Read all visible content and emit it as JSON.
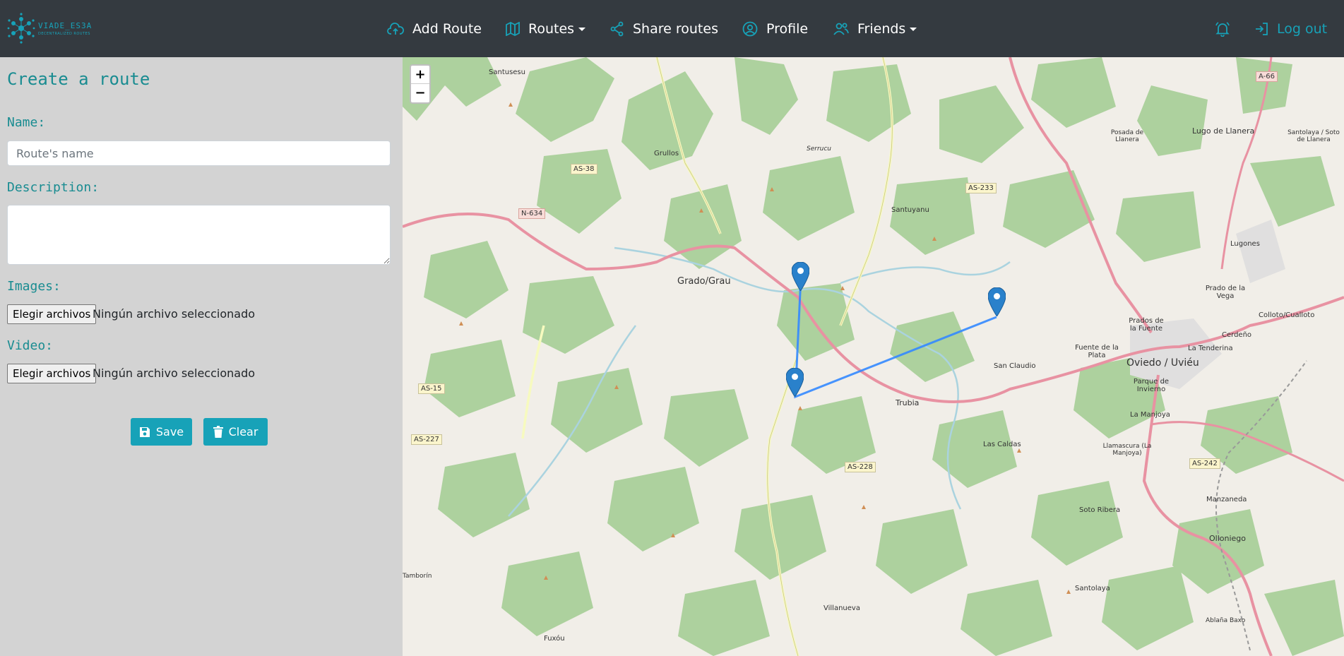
{
  "brand": {
    "title": "VIADE_ES3A",
    "subtitle": "DECENTRALIZED ROUTES",
    "logo_icon": "network-logo-icon"
  },
  "nav": {
    "add_route": "Add Route",
    "routes": "Routes",
    "share_routes": "Share routes",
    "profile": "Profile",
    "friends": "Friends",
    "notifications_icon": "bell-icon",
    "logout": "Log out"
  },
  "form": {
    "title": "Create a route",
    "name_label": "Name:",
    "name_placeholder": "Route's name",
    "name_value": "",
    "description_label": "Description:",
    "description_value": "",
    "images_label": "Images:",
    "video_label": "Video:",
    "choose_files": "Elegir archivos",
    "no_file": "Ningún archivo seleccionado",
    "save": "Save",
    "clear": "Clear"
  },
  "map": {
    "zoom_in": "+",
    "zoom_out": "−",
    "places": [
      "Santusesu",
      "Grullos",
      "Serrucu",
      "Santuyanu",
      "Grado/Grau",
      "Trubia",
      "San Claudio",
      "Las Caldas",
      "Posada de Llanera",
      "Lugo de Llanera",
      "Santolaya / Soto de Llanera",
      "Lugones",
      "Prado de la Vega",
      "Colloto/Cualloto",
      "Prados de la Fuente",
      "Cerdeño",
      "Fuente de la Plata",
      "La Tenderina",
      "Oviedo / Uviéu",
      "Parque de Invierno",
      "La Manjoya",
      "Llamascura (La Manjoya)",
      "Manzaneda",
      "Soto Ribera",
      "Olloniego",
      "Santolaya",
      "Ablaña Baxo",
      "Villanueva",
      "Fuxóu",
      "Tamborín"
    ],
    "roads": [
      "AS-38",
      "N-634",
      "AS-233",
      "A-66",
      "AS-15",
      "AS-227",
      "AS-228",
      "AS-242"
    ],
    "route_markers": 3,
    "colors": {
      "route_line": "#3388ff",
      "marker": "#2a81cb",
      "accent": "#17a2b8",
      "navbar": "#343a40",
      "sidebar": "#d3d3d3"
    }
  }
}
